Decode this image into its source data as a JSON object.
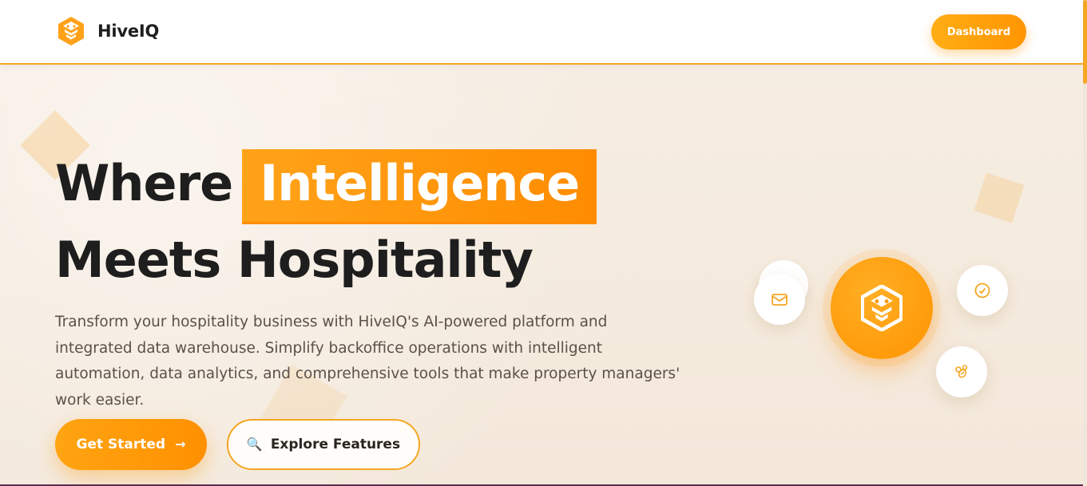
{
  "header": {
    "brand_name": "HiveIQ",
    "dashboard_label": "Dashboard"
  },
  "hero": {
    "headline_part1": "Where",
    "headline_highlight": "Intelligence",
    "headline_line2": "Meets Hospitality",
    "subtext": "Transform your hospitality business with HiveIQ's AI-powered platform and integrated data warehouse. Simplify backoffice operations with intelligent automation, data analytics, and comprehensive tools that make property managers' work easier.",
    "primary_cta": "Get Started",
    "primary_cta_icon": "→",
    "secondary_cta": "Explore Features",
    "secondary_cta_icon": "🔍"
  },
  "icons": {
    "brand": "hiveiq-logo-icon",
    "hub": "hiveiq-logo-icon",
    "orbit_1": "mail-icon",
    "orbit_2": "check-circle-icon",
    "orbit_3": "bee-icon"
  },
  "colors": {
    "accent": "#ff9a0a",
    "accent_light": "#ffad14",
    "background": "#f5ebde",
    "text_dark": "#1e1e1e",
    "text_body": "#5c5048"
  }
}
